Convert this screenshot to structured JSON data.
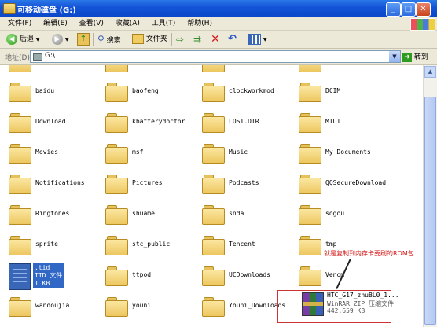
{
  "window": {
    "title": "可移动磁盘 (G:)",
    "buttons": {
      "minimize": "_",
      "maximize": "□",
      "close": "✕"
    }
  },
  "menu": {
    "items": [
      "文件(F)",
      "编辑(E)",
      "查看(V)",
      "收藏(A)",
      "工具(T)",
      "帮助(H)"
    ]
  },
  "toolbar": {
    "back_label": "后退",
    "search_label": "搜索",
    "folders_label": "文件夹"
  },
  "address": {
    "label": "地址(D)",
    "value": "G:\\",
    "go_label": "转到"
  },
  "top_partial": [
    "",
    "",
    "",
    ""
  ],
  "rows": [
    [
      "baidu",
      "baofeng",
      "clockworkmod",
      "DCIM"
    ],
    [
      "Download",
      "kbatterydoctor",
      "LOST.DIR",
      "MIUI"
    ],
    [
      "Movies",
      "msf",
      "Music",
      "My Documents"
    ],
    [
      "Notifications",
      "Pictures",
      "Podcasts",
      "QQSecureDownload"
    ],
    [
      "Ringtones",
      "shuame",
      "snda",
      "sogou"
    ],
    [
      "sprite",
      "stc_public",
      "Tencent",
      "tmp"
    ],
    [
      "",
      "ttpod",
      "UCDownloads",
      "Venom"
    ],
    [
      "wandoujia",
      "youni",
      "Youni_Downloads",
      ""
    ]
  ],
  "selected_file": {
    "name": ".tid",
    "type": "TID 文件",
    "size": "1 KB"
  },
  "rar_file": {
    "name": "HTC_G17_zhuBL0_1...",
    "type": "WinRAR ZIP 压缩文件",
    "size": "442,659 KB"
  },
  "annotation": "就是复制到内存卡要刷的ROM包"
}
